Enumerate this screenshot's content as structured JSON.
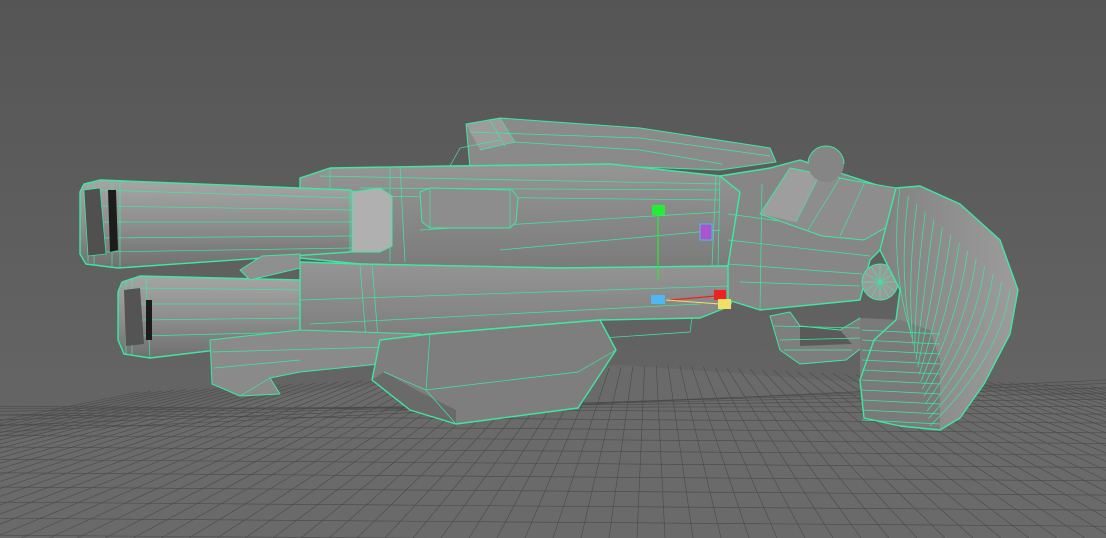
{
  "colors": {
    "background": "#5e5e5e",
    "background_top": "#5a5a5a",
    "floor": "#6a6a6a",
    "grid_line": "#4a4a4a",
    "mesh_fill": "#858585",
    "mesh_fill_light": "#9a9a9a",
    "mesh_fill_dark": "#6e6e6e",
    "wireframe": "#3ee8a2",
    "manipulator_y": "#22ee33",
    "manipulator_x": "#ee2222",
    "manipulator_z": "#4fb8f0",
    "manipulator_center": "#f2e066",
    "pivot_marker": "#aa55cc"
  },
  "viewport": {
    "object": "shotgun-wireframe-model",
    "grid": true,
    "wireframe_on_shaded": true
  },
  "manipulator": {
    "axes": [
      "x-axis-handle",
      "y-axis-handle",
      "z-axis-handle"
    ],
    "center": "center-handle"
  }
}
